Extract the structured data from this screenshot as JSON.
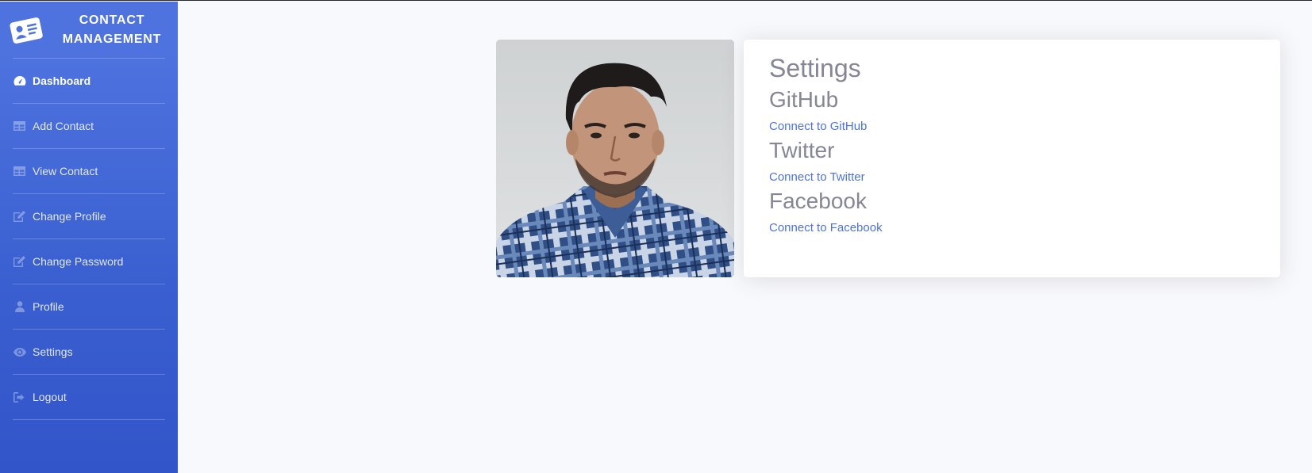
{
  "brand": {
    "title": "CONTACT MANAGEMENT",
    "icon": "contact-card-icon"
  },
  "sidebar": {
    "items": [
      {
        "label": "Dashboard",
        "icon": "dashboard-icon",
        "active": true
      },
      {
        "label": "Add Contact",
        "icon": "table-icon"
      },
      {
        "label": "View Contact",
        "icon": "table-icon"
      },
      {
        "label": "Change Profile",
        "icon": "edit-icon"
      },
      {
        "label": "Change Password",
        "icon": "edit-icon"
      },
      {
        "label": "Profile",
        "icon": "user-icon"
      },
      {
        "label": "Settings",
        "icon": "eye-icon"
      },
      {
        "label": "Logout",
        "icon": "sign-out-icon"
      }
    ]
  },
  "settings": {
    "title": "Settings",
    "sections": [
      {
        "heading": "GitHub",
        "link": "Connect to GitHub"
      },
      {
        "heading": "Twitter",
        "link": "Connect to Twitter"
      },
      {
        "heading": "Facebook",
        "link": "Connect to Facebook"
      }
    ]
  },
  "colors": {
    "primary": "#4e73df",
    "text_muted": "#858796",
    "background": "#f8f9fc"
  }
}
